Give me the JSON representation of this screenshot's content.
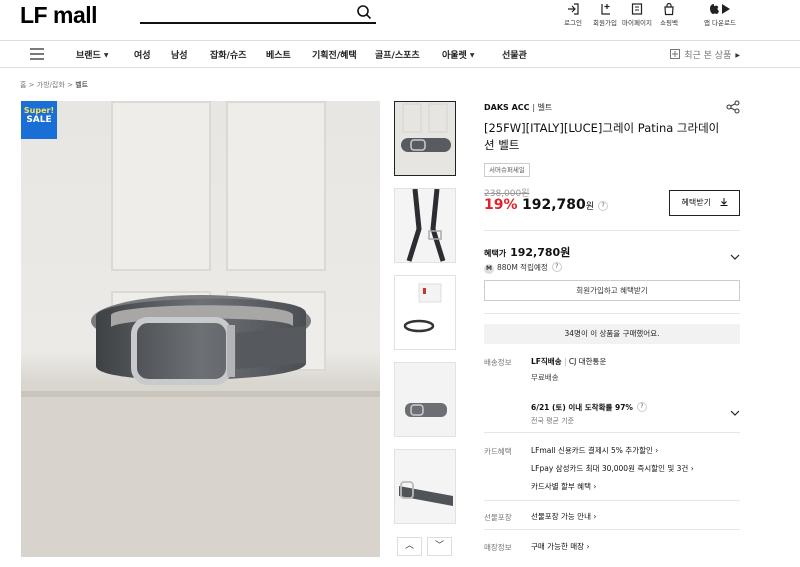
{
  "header": {
    "logo": "LF mall",
    "search_placeholder": "",
    "utils": [
      {
        "icon": "login-icon",
        "label": "로그인"
      },
      {
        "icon": "signup-icon",
        "label": "회원가입"
      },
      {
        "icon": "mypage-icon",
        "label": "마이페이지"
      },
      {
        "icon": "cart-icon",
        "label": "쇼핑백"
      },
      {
        "icon": "app-download-icon",
        "label": "앱 다운로드"
      }
    ]
  },
  "nav": {
    "items": [
      {
        "label": "브랜드",
        "caret": true
      },
      {
        "label": "여성",
        "caret": false
      },
      {
        "label": "남성",
        "caret": false
      },
      {
        "label": "잡화/슈즈",
        "caret": false
      },
      {
        "label": "베스트",
        "caret": false
      },
      {
        "label": "기획전/혜택",
        "caret": false
      },
      {
        "label": "골프/스포츠",
        "caret": false
      },
      {
        "label": "아울렛",
        "caret": true
      },
      {
        "label": "선물관",
        "caret": false
      }
    ],
    "recent": "최근 본 상품"
  },
  "breadcrumb": [
    "홈",
    "가방/잡화",
    "벨트"
  ],
  "badge": {
    "line1": "Super!",
    "line2": "SALE"
  },
  "thumb_nav": {
    "up": "︿",
    "down": "﹀"
  },
  "product": {
    "brand": "DAKS ACC",
    "category": "벨트",
    "title": "[25FW][ITALY][LUCE]그레이 Patina 그라데이션 벨트",
    "tag": "서머슈퍼세일",
    "original_price": "238,000원",
    "discount": "19%",
    "price": "192,780",
    "price_unit": "원",
    "benefit_button": "혜택받기",
    "benefit_label": "혜택가",
    "benefit_price": "192,780원",
    "point_badge": "M",
    "point_text": "880M 적립예정",
    "join_button": "회원가입하고 혜택받기",
    "notice": "34명이 이 상품을 구매했어요."
  },
  "info_rows": {
    "shipping_label": "배송정보",
    "shipping_method": "LF직배송",
    "shipping_carrier": "CJ 대한통운",
    "shipping_fee": "무료배송",
    "arrival": "6/21 (토) 이내 도착확률 97%",
    "arrival_sub": "전국 평균 기준",
    "card_label": "카드혜택",
    "card_1": "LFmall 신용카드 결제시 5% 추가할인",
    "card_2": "LFpay 삼성카드 최대 30,000원 즉시할인 및 3건",
    "card_3": "카드사별 할부 혜택",
    "gift_label": "선물포장",
    "gift_val": "선물포장 가능 안내",
    "store_label": "매장정보",
    "store_val": "구매 가능한 매장"
  },
  "colors": {
    "discount": "#e0222b",
    "badge_bg": "#1a6fd6",
    "badge_text": "#ffe34d"
  }
}
